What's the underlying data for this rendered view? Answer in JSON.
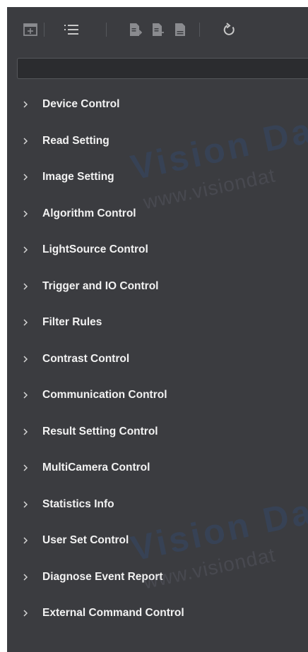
{
  "toolbar": {
    "buttons": [
      {
        "icon": "expand-all-icon"
      },
      {
        "icon": "list-view-icon"
      },
      {
        "icon": "import-config-icon"
      },
      {
        "icon": "export-config-icon"
      },
      {
        "icon": "save-config-icon"
      },
      {
        "icon": "refresh-icon"
      }
    ]
  },
  "search": {
    "value": "",
    "placeholder": ""
  },
  "tree": {
    "items": [
      {
        "label": "Device Control"
      },
      {
        "label": "Read Setting"
      },
      {
        "label": "Image Setting"
      },
      {
        "label": "Algorithm Control"
      },
      {
        "label": "LightSource Control"
      },
      {
        "label": "Trigger and IO Control"
      },
      {
        "label": "Filter Rules"
      },
      {
        "label": "Contrast Control"
      },
      {
        "label": "Communication Control"
      },
      {
        "label": "Result Setting Control"
      },
      {
        "label": "MultiCamera Control"
      },
      {
        "label": "Statistics Info"
      },
      {
        "label": "User Set Control"
      },
      {
        "label": "Diagnose Event Report"
      },
      {
        "label": "External Command Control"
      }
    ]
  },
  "watermark": {
    "brand": "Vision Da",
    "url": "www.visiondat"
  },
  "colors": {
    "panel_bg": "#3b3c40",
    "text": "#f2f2f2",
    "icon": "#c8c8c8",
    "icon_dim": "#8a8b8f",
    "search_bg": "#2b2c2f"
  }
}
